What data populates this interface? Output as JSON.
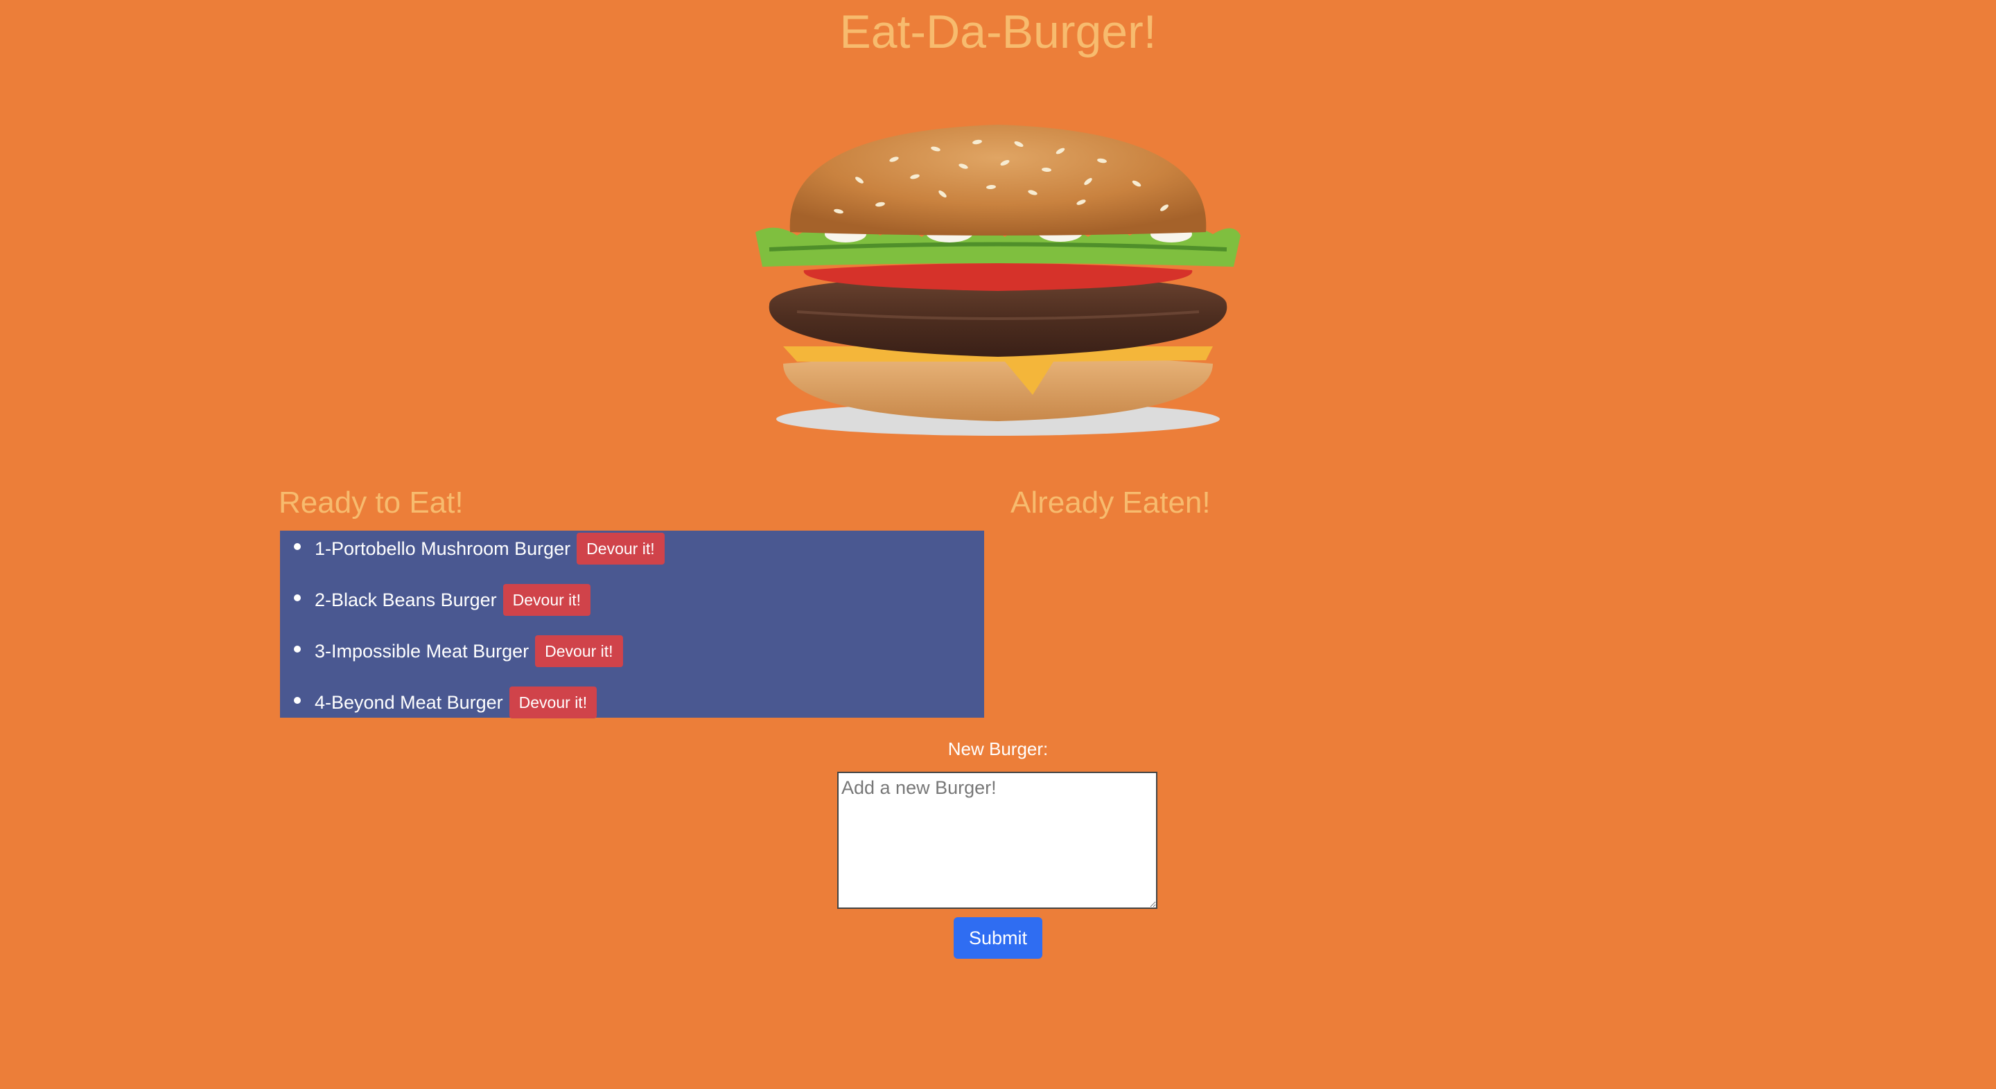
{
  "header": {
    "title": "Eat-Da-Burger!"
  },
  "hero": {
    "image_name": "burger-image"
  },
  "ready": {
    "heading": "Ready to Eat!",
    "items": [
      {
        "label": "1-Portobello Mushroom Burger",
        "button": "Devour it!"
      },
      {
        "label": "2-Black Beans Burger",
        "button": "Devour it!"
      },
      {
        "label": "3-Impossible Meat Burger",
        "button": "Devour it!"
      },
      {
        "label": "4-Beyond Meat Burger",
        "button": "Devour it!"
      }
    ]
  },
  "eaten": {
    "heading": "Already Eaten!",
    "items": []
  },
  "form": {
    "label": "New Burger:",
    "placeholder": "Add a new Burger!",
    "value": "",
    "submit_label": "Submit"
  },
  "colors": {
    "background": "#ec7e39",
    "heading": "#f7bb6e",
    "ready_panel": "#4a5891",
    "devour_button": "#d0434a",
    "submit_button": "#2f6df2"
  }
}
